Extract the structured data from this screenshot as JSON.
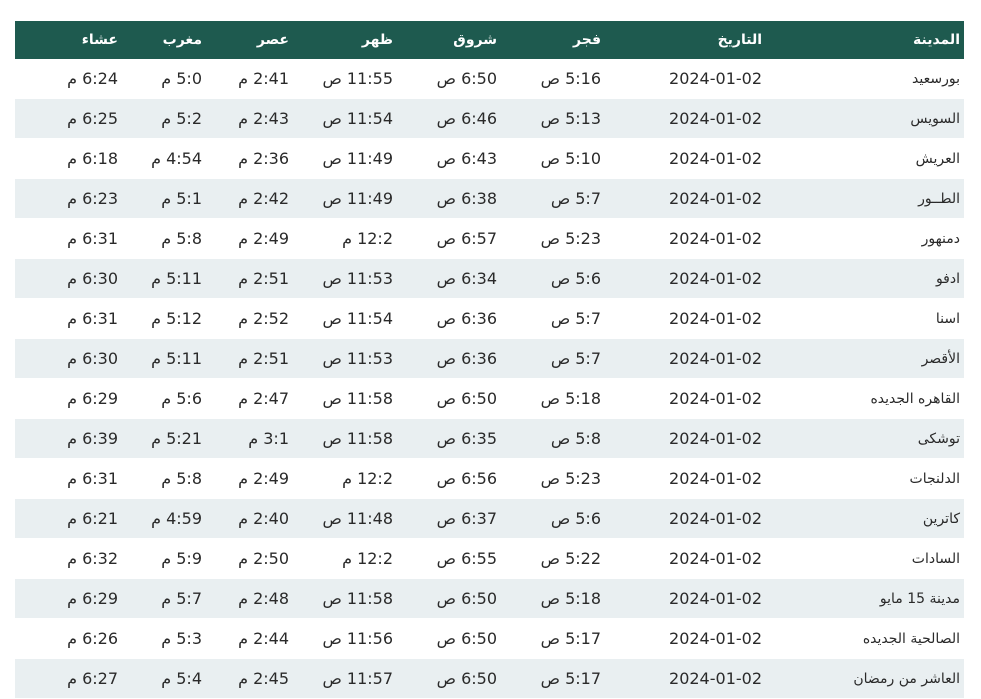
{
  "headers": {
    "city": "المدينة",
    "date": "التاريخ",
    "fajr": "فجر",
    "sunrise": "شروق",
    "dhuhr": "ظهر",
    "asr": "عصر",
    "maghrib": "مغرب",
    "isha": "عشاء"
  },
  "rows": [
    {
      "city": "بورسعيد",
      "date": "2024-01-02",
      "fajr": "5:16 ص",
      "sunrise": "6:50 ص",
      "dhuhr": "11:55 ص",
      "asr": "2:41 م",
      "maghrib": "5:0 م",
      "isha": "6:24 م"
    },
    {
      "city": "السويس",
      "date": "2024-01-02",
      "fajr": "5:13 ص",
      "sunrise": "6:46 ص",
      "dhuhr": "11:54 ص",
      "asr": "2:43 م",
      "maghrib": "5:2 م",
      "isha": "6:25 م"
    },
    {
      "city": "العريش",
      "date": "2024-01-02",
      "fajr": "5:10 ص",
      "sunrise": "6:43 ص",
      "dhuhr": "11:49 ص",
      "asr": "2:36 م",
      "maghrib": "4:54 م",
      "isha": "6:18 م"
    },
    {
      "city": "الطــور",
      "date": "2024-01-02",
      "fajr": "5:7 ص",
      "sunrise": "6:38 ص",
      "dhuhr": "11:49 ص",
      "asr": "2:42 م",
      "maghrib": "5:1 م",
      "isha": "6:23 م"
    },
    {
      "city": "دمنهور",
      "date": "2024-01-02",
      "fajr": "5:23 ص",
      "sunrise": "6:57 ص",
      "dhuhr": "12:2 م",
      "asr": "2:49 م",
      "maghrib": "5:8 م",
      "isha": "6:31 م"
    },
    {
      "city": "ادفو",
      "date": "2024-01-02",
      "fajr": "5:6 ص",
      "sunrise": "6:34 ص",
      "dhuhr": "11:53 ص",
      "asr": "2:51 م",
      "maghrib": "5:11 م",
      "isha": "6:30 م"
    },
    {
      "city": "اسنا",
      "date": "2024-01-02",
      "fajr": "5:7 ص",
      "sunrise": "6:36 ص",
      "dhuhr": "11:54 ص",
      "asr": "2:52 م",
      "maghrib": "5:12 م",
      "isha": "6:31 م"
    },
    {
      "city": "الأقصر",
      "date": "2024-01-02",
      "fajr": "5:7 ص",
      "sunrise": "6:36 ص",
      "dhuhr": "11:53 ص",
      "asr": "2:51 م",
      "maghrib": "5:11 م",
      "isha": "6:30 م"
    },
    {
      "city": "القاهره الجديده",
      "date": "2024-01-02",
      "fajr": "5:18 ص",
      "sunrise": "6:50 ص",
      "dhuhr": "11:58 ص",
      "asr": "2:47 م",
      "maghrib": "5:6 م",
      "isha": "6:29 م"
    },
    {
      "city": "توشكى",
      "date": "2024-01-02",
      "fajr": "5:8 ص",
      "sunrise": "6:35 ص",
      "dhuhr": "11:58 ص",
      "asr": "3:1 م",
      "maghrib": "5:21 م",
      "isha": "6:39 م"
    },
    {
      "city": "الدلنجات",
      "date": "2024-01-02",
      "fajr": "5:23 ص",
      "sunrise": "6:56 ص",
      "dhuhr": "12:2 م",
      "asr": "2:49 م",
      "maghrib": "5:8 م",
      "isha": "6:31 م"
    },
    {
      "city": "كاترين",
      "date": "2024-01-02",
      "fajr": "5:6 ص",
      "sunrise": "6:37 ص",
      "dhuhr": "11:48 ص",
      "asr": "2:40 م",
      "maghrib": "4:59 م",
      "isha": "6:21 م"
    },
    {
      "city": "السادات",
      "date": "2024-01-02",
      "fajr": "5:22 ص",
      "sunrise": "6:55 ص",
      "dhuhr": "12:2 م",
      "asr": "2:50 م",
      "maghrib": "5:9 م",
      "isha": "6:32 م"
    },
    {
      "city": "مدينة 15 مايو",
      "date": "2024-01-02",
      "fajr": "5:18 ص",
      "sunrise": "6:50 ص",
      "dhuhr": "11:58 ص",
      "asr": "2:48 م",
      "maghrib": "5:7 م",
      "isha": "6:29 م"
    },
    {
      "city": "الصالحية الجديده",
      "date": "2024-01-02",
      "fajr": "5:17 ص",
      "sunrise": "6:50 ص",
      "dhuhr": "11:56 ص",
      "asr": "2:44 م",
      "maghrib": "5:3 م",
      "isha": "6:26 م"
    },
    {
      "city": "العاشر من رمضان",
      "date": "2024-01-02",
      "fajr": "5:17 ص",
      "sunrise": "6:50 ص",
      "dhuhr": "11:57 ص",
      "asr": "2:45 م",
      "maghrib": "5:4 م",
      "isha": "6:27 م"
    }
  ]
}
